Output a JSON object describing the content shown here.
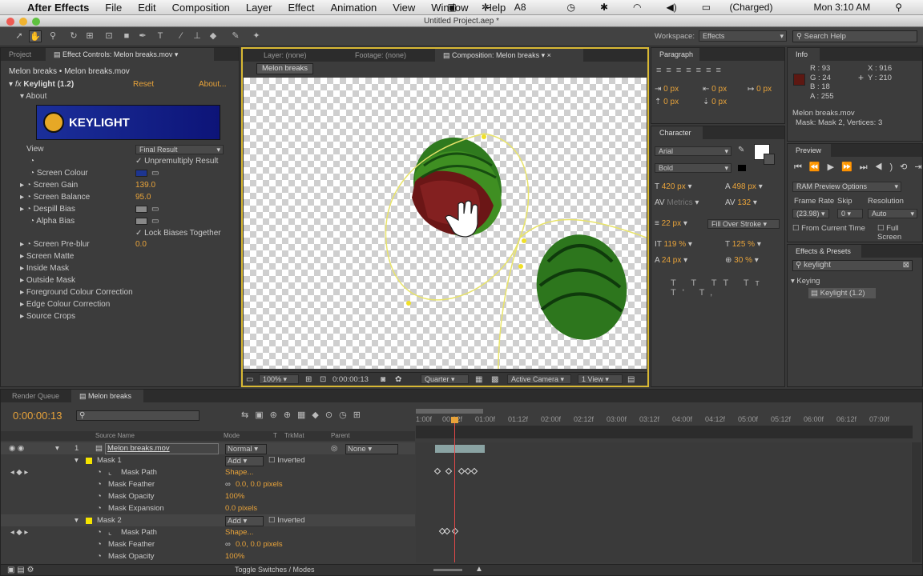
{
  "menubar": {
    "apple": "",
    "app_name": "After Effects",
    "items": [
      "File",
      "Edit",
      "Composition",
      "Layer",
      "Effect",
      "Animation",
      "View",
      "Window",
      "Help"
    ],
    "adobe_count": "8",
    "battery": "(Charged)",
    "clock": "Mon 3:10 AM"
  },
  "window": {
    "title": "Untitled Project.aep *"
  },
  "toolbar": {
    "workspace_label": "Workspace:",
    "workspace_value": "Effects",
    "search_help": "Search Help"
  },
  "project_panel": {
    "tabs": [
      "Project",
      "Effect Controls: Melon breaks.mov"
    ],
    "breadcrumb": "Melon breaks • Melon breaks.mov",
    "effect_name": "Keylight (1.2)",
    "reset": "Reset",
    "about": "About...",
    "about_section": "About",
    "logo_text": "KEYLIGHT",
    "rows": [
      {
        "label": "View",
        "value": "Final Result"
      },
      {
        "label": "",
        "value": "Unpremultiply Result"
      },
      {
        "label": "Screen Colour",
        "value": ""
      },
      {
        "label": "Screen Gain",
        "value": "139.0"
      },
      {
        "label": "Screen Balance",
        "value": "95.0"
      },
      {
        "label": "Despill Bias",
        "value": ""
      },
      {
        "label": "Alpha Bias",
        "value": ""
      },
      {
        "label": "",
        "value": "Lock Biases Together"
      },
      {
        "label": "Screen Pre-blur",
        "value": "0.0"
      },
      {
        "label": "Screen Matte",
        "value": ""
      },
      {
        "label": "Inside Mask",
        "value": ""
      },
      {
        "label": "Outside Mask",
        "value": ""
      },
      {
        "label": "Foreground Colour Correction",
        "value": ""
      },
      {
        "label": "Edge Colour Correction",
        "value": ""
      },
      {
        "label": "Source Crops",
        "value": ""
      }
    ]
  },
  "comp_panel": {
    "tabs": [
      "Layer: (none)",
      "Footage: (none)",
      "Composition: Melon breaks"
    ],
    "comp_tab_label": "Melon breaks",
    "zoom": "100%",
    "timecode": "0:00:00:13",
    "resolution": "Quarter",
    "camera": "Active Camera",
    "views": "1 View"
  },
  "paragraph_panel": {
    "tab": "Paragraph",
    "indents": [
      "0 px",
      "0 px",
      "0 px",
      "0 px",
      "0 px"
    ]
  },
  "character_panel": {
    "tab": "Character",
    "font": "Arial",
    "style": "Bold",
    "size": "420 px",
    "leading": "498 px",
    "kerning": "Metrics",
    "tracking": "132",
    "stroke_width": "22 px",
    "stroke_mode": "Fill Over Stroke",
    "vscale": "119 %",
    "hscale": "125 %",
    "baseline": "24 px",
    "tsume": "30 %"
  },
  "info_panel": {
    "tab": "Info",
    "r": "R : 93",
    "g": "G : 24",
    "b": "B : 18",
    "a": "A : 255",
    "x": "X : 916",
    "y": "Y : 210",
    "line1": "Melon breaks.mov",
    "line2": "Mask: Mask 2, Vertices: 3",
    "swatch_color": "#5d1812"
  },
  "preview_panel": {
    "tab": "Preview",
    "ram_options": "RAM Preview Options",
    "frame_rate_label": "Frame Rate",
    "skip_label": "Skip",
    "resolution_label": "Resolution",
    "frame_rate": "(23.98)",
    "skip": "0",
    "resolution": "Auto",
    "from_current": "From Current Time",
    "full_screen": "Full Screen"
  },
  "effects_panel": {
    "tab": "Effects & Presets",
    "search": "keylight",
    "category": "Keying",
    "item": "Keylight (1.2)"
  },
  "timeline": {
    "tabs": [
      "Render Queue",
      "Melon breaks"
    ],
    "timecode": "0:00:00:13",
    "col_source": "Source Name",
    "col_mode": "Mode",
    "col_t": "T",
    "col_trkmat": "TrkMat",
    "col_parent": "Parent",
    "ruler": [
      "1:00f",
      "00:12f",
      "01:00f",
      "01:12f",
      "02:00f",
      "02:12f",
      "03:00f",
      "03:12f",
      "04:00f",
      "04:12f",
      "05:00f",
      "05:12f",
      "06:00f",
      "06:12f",
      "07:00f"
    ],
    "layer": {
      "num": "1",
      "name": "Melon breaks.mov",
      "mode": "Normal",
      "parent": "None"
    },
    "rows": [
      {
        "name": "Mask 1",
        "mode": "Add",
        "inverted": "Inverted"
      },
      {
        "name": "Mask Path",
        "value": "Shape..."
      },
      {
        "name": "Mask Feather",
        "value": "0.0, 0.0 pixels"
      },
      {
        "name": "Mask Opacity",
        "value": "100%"
      },
      {
        "name": "Mask Expansion",
        "value": "0.0 pixels"
      },
      {
        "name": "Mask 2",
        "mode": "Add",
        "inverted": "Inverted"
      },
      {
        "name": "Mask Path",
        "value": "Shape..."
      },
      {
        "name": "Mask Feather",
        "value": "0.0, 0.0 pixels"
      },
      {
        "name": "Mask Opacity",
        "value": "100%"
      }
    ],
    "toggle": "Toggle Switches / Modes"
  }
}
